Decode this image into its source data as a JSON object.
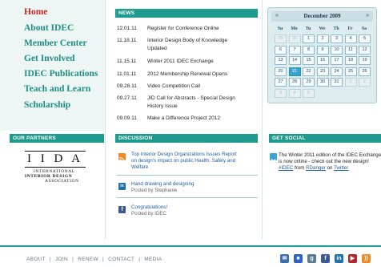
{
  "nav": {
    "items": [
      {
        "label": "Home",
        "active": true
      },
      {
        "label": "About IDEC"
      },
      {
        "label": "Member Center"
      },
      {
        "label": "Get Involved"
      },
      {
        "label": "IDEC Publications"
      },
      {
        "label": "Teach and Learn"
      },
      {
        "label": "Scholarship"
      }
    ]
  },
  "news": {
    "heading": "NEWS",
    "items": [
      {
        "date": "12.01.11",
        "title": "Register for Conference Online"
      },
      {
        "date": "11.18.11",
        "title": "Interior Design Body of Knowledge Updated"
      },
      {
        "date": "11.15.11",
        "title": "Winter 2011 IDEC Exchange"
      },
      {
        "date": "11.01.11",
        "title": "2012 Membership Renewal Opens"
      },
      {
        "date": "09.28.11",
        "title": "Video Competition Call"
      },
      {
        "date": "09.27.11",
        "title": "JID Call for Abstracts - Special Design History Issue"
      },
      {
        "date": "09.09.11",
        "title": "Make a Difference Project 2012"
      }
    ]
  },
  "calendar": {
    "title": "December 2009",
    "prev": "«",
    "next": "»",
    "weekdays": [
      "Su",
      "Mo",
      "Tu",
      "We",
      "Th",
      "Fr",
      "Sa"
    ],
    "days": [
      "29",
      "30",
      "1",
      "2",
      "3",
      "4",
      "5",
      "6",
      "7",
      "8",
      "9",
      "10",
      "11",
      "12",
      "13",
      "14",
      "15",
      "16",
      "17",
      "18",
      "19",
      "20",
      "21",
      "22",
      "23",
      "24",
      "25",
      "26",
      "27",
      "28",
      "29",
      "30",
      "31",
      "1",
      "2",
      "3",
      "4",
      "5"
    ],
    "selected": "21"
  },
  "partners": {
    "heading": "OUR PARTNERS",
    "logo_letters": "I I D A",
    "logo_line1": "INTERNATIONAL",
    "logo_line2": "INTERIOR DESIGN",
    "logo_line3": "ASSOCIATION"
  },
  "discussion": {
    "heading": "DISCUSSION",
    "items": [
      {
        "title": "Top Interior Design Organizations Issues Report on design's impact on public Health, Safety and Welfare",
        "icon": "rss-icon",
        "color": "#f08a24"
      },
      {
        "title": "Hand drawing and designing",
        "sub": "Posted by Stephanie",
        "icon": "linkedin-icon",
        "color": "#1f6fa8"
      },
      {
        "title": "Congratulations!",
        "sub": "Posted by IDEC",
        "icon": "facebook-icon",
        "color": "#3b5998"
      }
    ]
  },
  "social": {
    "heading": "GET SOCIAL",
    "text1": "The Winter 2011 edition of the IDEC Exchange",
    "text2": "is now online - check out the new design!",
    "hashtag": "#IDEC",
    "from": "from",
    "user": "RDanger",
    "on": "on",
    "network": "Twitter"
  },
  "footer": {
    "links": [
      "ABOUT",
      "JOIN",
      "RENEW",
      "CONTACT",
      "MEDIA"
    ],
    "separator": "|",
    "social_icons": [
      {
        "name": "mail-icon",
        "color": "#3a6fb0",
        "glyph": "✉"
      },
      {
        "name": "delicious-icon",
        "color": "#2c63c7",
        "glyph": "■"
      },
      {
        "name": "google-plus-icon",
        "color": "#5b7a93",
        "glyph": "g"
      },
      {
        "name": "facebook-icon",
        "color": "#3b5998",
        "glyph": "f"
      },
      {
        "name": "linkedin-icon",
        "color": "#1f6fa8",
        "glyph": "in"
      },
      {
        "name": "youtube-icon",
        "color": "#b6262a",
        "glyph": "▶"
      },
      {
        "name": "rss-icon",
        "color": "#f08a24",
        "glyph": "))"
      }
    ]
  },
  "colors": {
    "accent": "#1e9b8e",
    "active_nav": "#c62a24",
    "link": "#1f5b9e"
  }
}
